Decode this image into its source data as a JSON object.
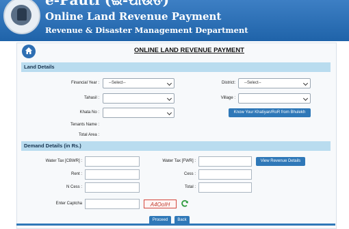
{
  "header": {
    "title": "e-Pauti (ଇ-ପାଉତି)",
    "subtitle": "Online Land Revenue Payment",
    "department": "Revenue & Disaster Management Department"
  },
  "page": {
    "title": "ONLINE LAND REVENUE PAYMENT"
  },
  "land_details": {
    "heading": "Land Details",
    "financial_year": {
      "label": "Financial Year :",
      "value": "--Select--"
    },
    "district": {
      "label": "District:",
      "value": "--Select--"
    },
    "tahasil": {
      "label": "Tahasil :",
      "value": ""
    },
    "village": {
      "label": "Village :",
      "value": ""
    },
    "khata_no": {
      "label": "Khata No :",
      "value": ""
    },
    "khatiyan_button": "Know Your Khatiyan/RoR from Bhulekh",
    "tenants_name": {
      "label": "Tenants Name :"
    },
    "total_area": {
      "label": "Total Area :"
    }
  },
  "demand_details": {
    "heading": "Demand Details (in Rs.)",
    "water_tax_cbwr": {
      "label": "Water Tax [CBWR] :",
      "value": ""
    },
    "water_tax_fwr": {
      "label": "Water Tax [FWR] :",
      "value": ""
    },
    "view_revenue_button": "View Revenue Details",
    "rent": {
      "label": "Rent :",
      "value": ""
    },
    "cess": {
      "label": "Cess :",
      "value": ""
    },
    "n_cess": {
      "label": "N Cess :",
      "value": ""
    },
    "total": {
      "label": "Total :",
      "value": ""
    }
  },
  "captcha": {
    "label": "Enter Captcha",
    "value": "",
    "code": "A4OoIH"
  },
  "actions": {
    "proceed": "Proceed",
    "back": "Back"
  },
  "colors": {
    "header_blue": "#1f63a9",
    "section_bar": "#b9dcef",
    "button_blue": "#2f78b8",
    "captcha_red": "#c0392b",
    "refresh_green": "#2e9b3e"
  }
}
